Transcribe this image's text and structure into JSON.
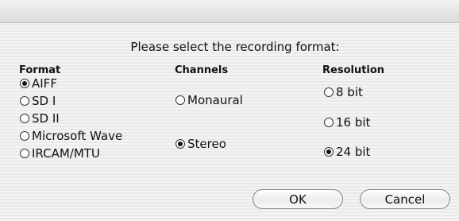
{
  "prompt": "Please select the recording format:",
  "format": {
    "heading": "Format",
    "options": [
      {
        "label": "AIFF",
        "selected": true
      },
      {
        "label": "SD I",
        "selected": false
      },
      {
        "label": "SD II",
        "selected": false
      },
      {
        "label": "Microsoft Wave",
        "selected": false
      },
      {
        "label": "IRCAM/MTU",
        "selected": false
      }
    ]
  },
  "channels": {
    "heading": "Channels",
    "options": [
      {
        "label": "Monaural",
        "selected": false
      },
      {
        "label": "Stereo",
        "selected": true
      }
    ]
  },
  "resolution": {
    "heading": "Resolution",
    "options": [
      {
        "label": "8 bit",
        "selected": false
      },
      {
        "label": "16 bit",
        "selected": false
      },
      {
        "label": "24 bit",
        "selected": true
      }
    ]
  },
  "buttons": {
    "ok": "OK",
    "cancel": "Cancel"
  }
}
